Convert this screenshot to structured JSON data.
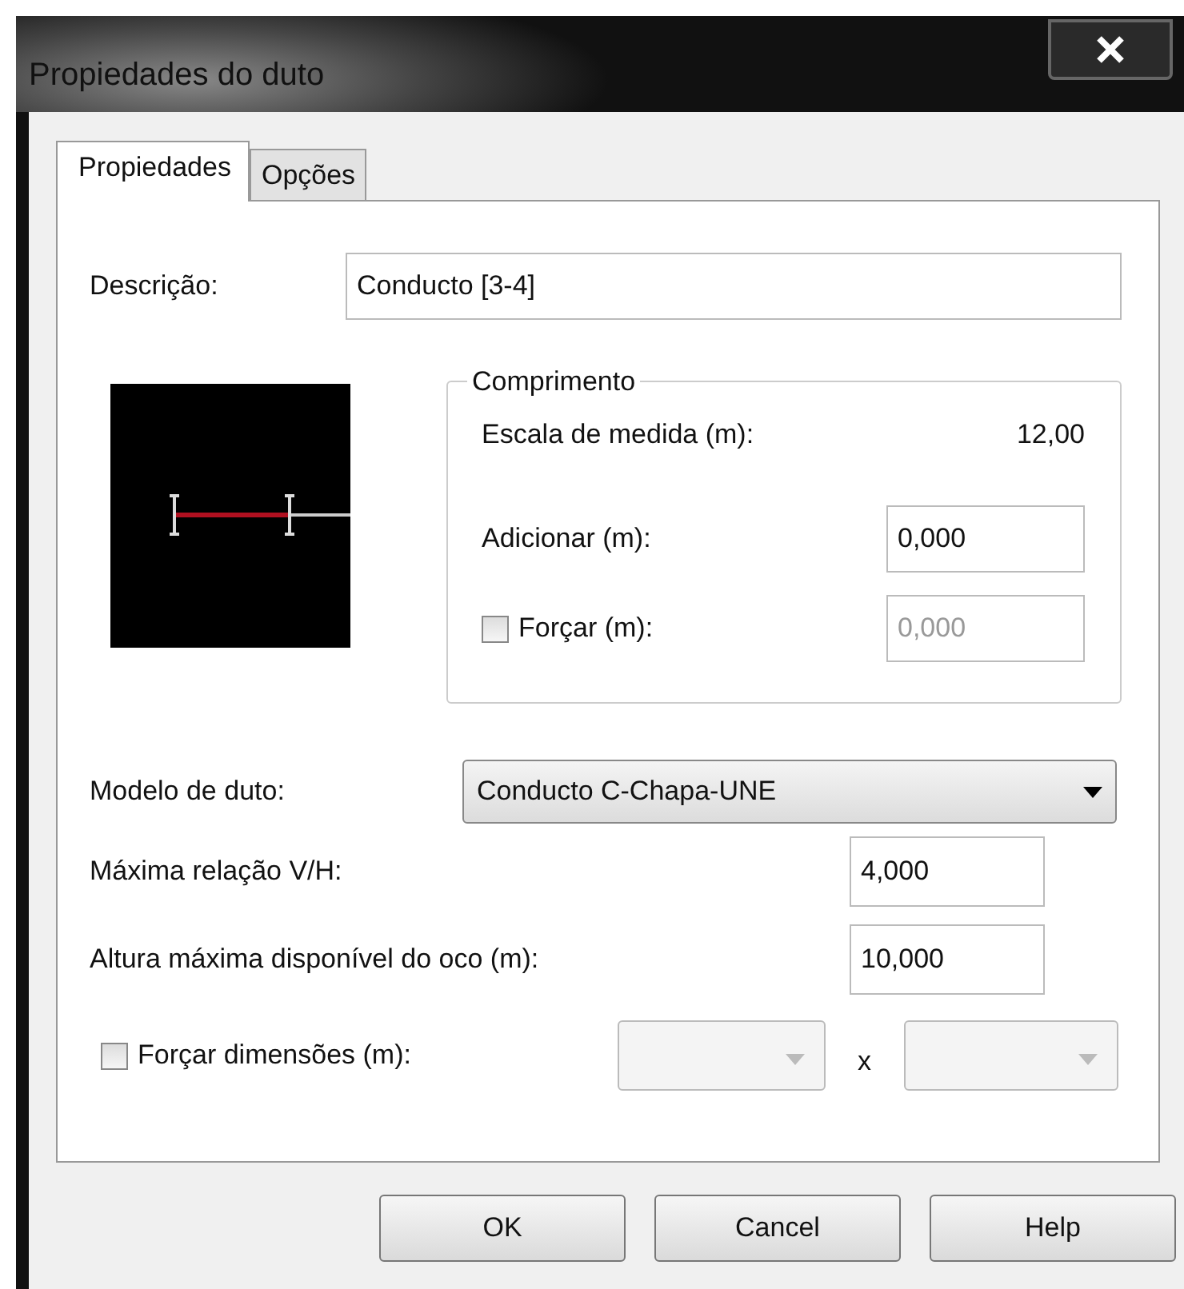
{
  "window": {
    "title": "Propiedades do duto"
  },
  "tabs": [
    {
      "label": "Propiedades",
      "selected": true
    },
    {
      "label": "Opções",
      "selected": false
    }
  ],
  "description": {
    "label": "Descrição:",
    "value": "Conducto [3-4]"
  },
  "length_group": {
    "title": "Comprimento",
    "scale_label": "Escala de medida (m):",
    "scale_value": "12,00",
    "add_label": "Adicionar (m):",
    "add_value": "0,000",
    "force": {
      "label": "Forçar (m):",
      "checked": false
    },
    "force_value": "0,000"
  },
  "duct_model": {
    "label": "Modelo de duto:",
    "value": "Conducto C-Chapa-UNE"
  },
  "max_ratio": {
    "label": "Máxima relação V/H:",
    "value": "4,000"
  },
  "max_height": {
    "label": "Altura máxima disponível do oco (m):",
    "value": "10,000"
  },
  "force_dimensions": {
    "label": "Forçar dimensões (m):",
    "checked": false,
    "separator": "x"
  },
  "buttons": [
    "OK",
    "Cancel",
    "Help"
  ]
}
